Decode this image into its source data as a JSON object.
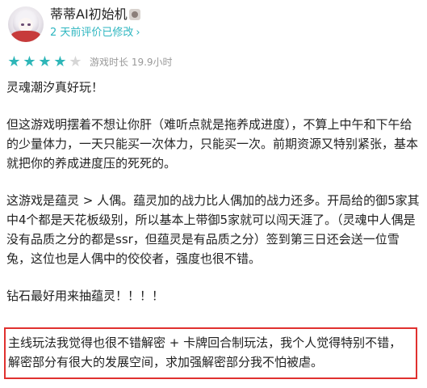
{
  "user": {
    "name": "蒂蒂AI初始机",
    "badge_icon": "cat-face-icon",
    "meta": "2 天前评价已修改",
    "meta_chevron": "›"
  },
  "rating": {
    "stars": 4,
    "max": 5,
    "playtime_label": "游戏时长 19.9小时"
  },
  "review": {
    "title": "灵魂潮汐真好玩！",
    "paragraphs": [
      "但这游戏明摆着不想让你肝（难听点就是拖养成进度），不算上中午和下午给的少量体力，一天只能买一次体力，只能买一次。前期资源又特别紧张，基本就把你的养成进度压的死死的。",
      "这游戏是蕴灵 > 人偶。蕴灵加的战力比人偶加的战力还多。开局给的御5家其中4个都是天花板级别，所以基本上带御5家就可以闯天涯了。（灵魂中人偶是没有品质之分的都是ssr，但蕴灵是有品质之分）签到第三日还会送一位雪兔，这位也是人偶中的佼佼者，强度也很不错。",
      "钻石最好用来抽蕴灵！！！！"
    ],
    "highlighted": "主线玩法我觉得也很不错解密 + 卡牌回合制玩法，我个人觉得特别不错，解密部分有很大的发展空间，求加强解密部分我不怕被虐。"
  },
  "colors": {
    "accent": "#2eb6c0",
    "star_on": "#2eb6b8",
    "star_off": "#d6d6d6",
    "highlight_border": "#e0312f"
  }
}
